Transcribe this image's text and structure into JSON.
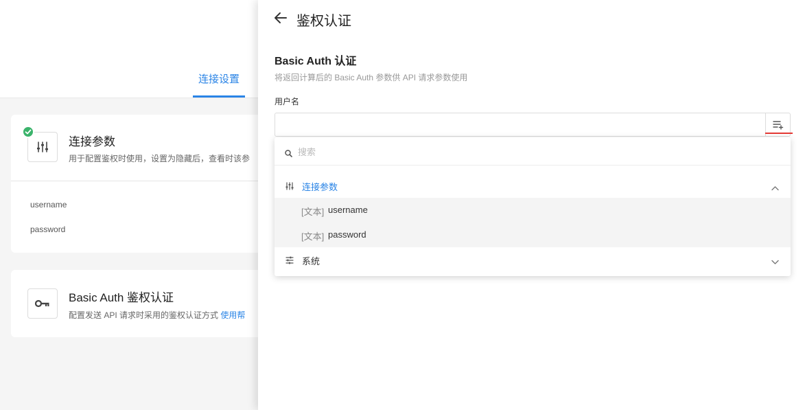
{
  "background": {
    "tab_label": "连接设置",
    "card1": {
      "title": "连接参数",
      "desc": "用于配置鉴权时使用，设置为隐藏后，查看时该参",
      "params": [
        "username",
        "password"
      ]
    },
    "card2": {
      "title": "Basic Auth 鉴权认证",
      "desc": "配置发送 API 请求时采用的鉴权认证方式",
      "help_link": "使用帮"
    }
  },
  "drawer": {
    "title": "鉴权认证",
    "section_title": "Basic Auth 认证",
    "section_desc": "将返回计算后的 Basic Auth 参数供 API 请求参数使用",
    "field_label": "用户名",
    "field_value": ""
  },
  "dropdown": {
    "search_placeholder": "搜索",
    "groups": [
      {
        "label": "连接参数",
        "expanded": true,
        "items": [
          {
            "type": "[文本]",
            "name": "username"
          },
          {
            "type": "[文本]",
            "name": "password"
          }
        ]
      },
      {
        "label": "系统",
        "expanded": false
      }
    ]
  },
  "colors": {
    "accent": "#2a84e6",
    "success": "#3bb36b",
    "highlight": "#e53935"
  },
  "icons": {
    "back": "arrow-left-icon",
    "sliders": "sliders-icon",
    "key": "key-icon",
    "check": "check-icon",
    "insert_variable": "list-add-icon",
    "search": "search-icon",
    "chevron_up": "chevron-up-icon",
    "chevron_down": "chevron-down-icon"
  }
}
